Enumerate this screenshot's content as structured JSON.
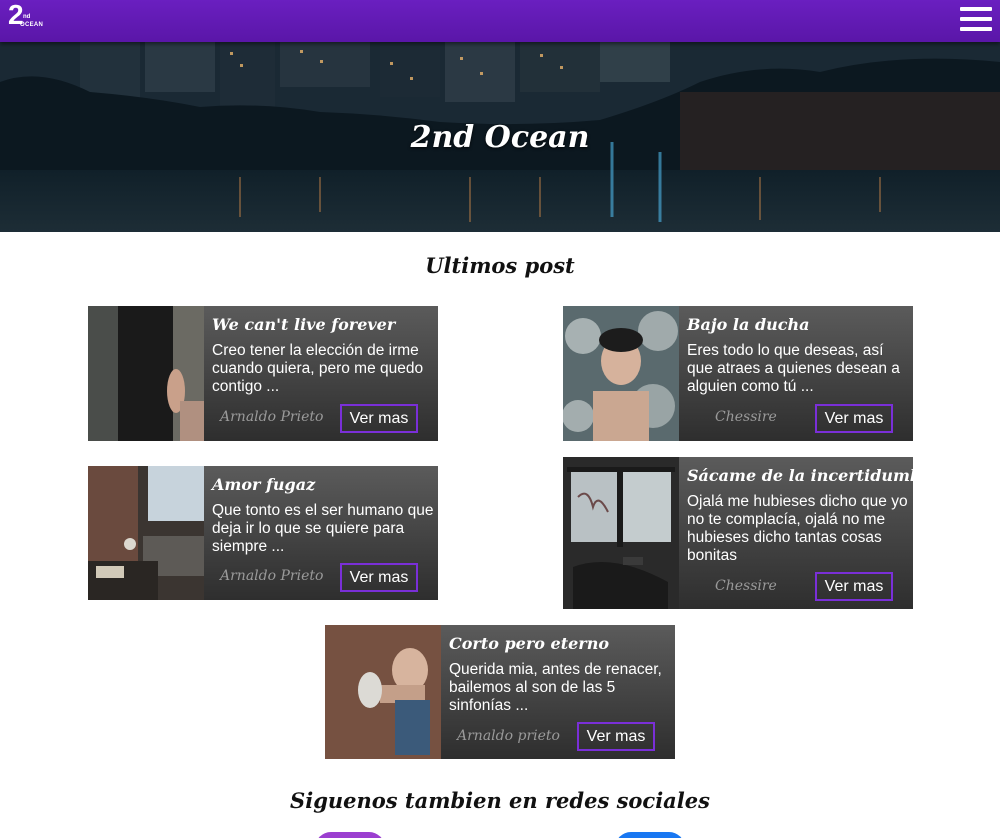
{
  "nav": {
    "logo_number": "2",
    "logo_superscript": "nd",
    "logo_word": "OCEAN",
    "menu_icon": "hamburger-menu-icon"
  },
  "hero": {
    "title": "2nd Ocean"
  },
  "latest": {
    "heading": "Ultimos post"
  },
  "posts": [
    {
      "title": "We can't live forever",
      "excerpt": "Creo tener la elección de irme cuando quiera, pero me quedo contigo ...",
      "author": "Arnaldo Prieto",
      "button": "Ver mas"
    },
    {
      "title": "Bajo la ducha",
      "excerpt": "Eres todo lo que deseas, así que atraes a quienes desean a alguien como tú ...",
      "author": "Chessire",
      "button": "Ver mas"
    },
    {
      "title": "Amor fugaz",
      "excerpt": "Que tonto es el ser humano que deja ir lo que se quiere para siempre ...",
      "author": "Arnaldo Prieto",
      "button": "Ver mas"
    },
    {
      "title": "Sácame de la incertidumbre.",
      "excerpt": "Ojalá me hubieses dicho que yo no te complacía, ojalá no me hubieses dicho tantas cosas bonitas",
      "author": "Chessire",
      "button": "Ver mas"
    },
    {
      "title": "Corto pero eterno",
      "excerpt": "Querida mia, antes de renacer, bailemos al son de las 5 sinfonías ...",
      "author": "Arnaldo prieto",
      "button": "Ver mas"
    }
  ],
  "social": {
    "heading": "Siguenos tambien en redes sociales",
    "colors": [
      "#9b3fd0",
      "#1877f2"
    ]
  },
  "colors": {
    "nav": "#5e18b0",
    "accent": "#7a2fd8"
  }
}
